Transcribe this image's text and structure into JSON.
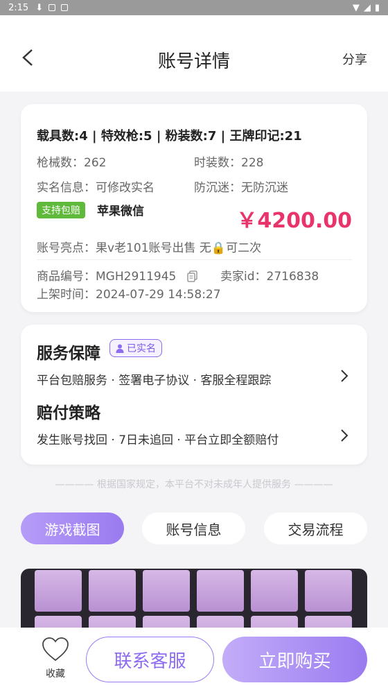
{
  "status_bar": {
    "time": "2:15"
  },
  "header": {
    "title": "账号详情",
    "share": "分享"
  },
  "account": {
    "summary": "载具数:4 | 特效枪:5 | 粉装数:7 | 王牌印记:21",
    "gun_label": "枪械数：",
    "gun_value": "262",
    "outfit_label": "时装数：",
    "outfit_value": "228",
    "realname_label": "实名信息：",
    "realname_value": "可修改实名",
    "addiction_label": "防沉迷：",
    "addiction_value": "无防沉迷",
    "guarantee_tag": "支持包赔",
    "platforms": "苹果微信",
    "price": "￥4200.00",
    "highlight_label": "账号亮点：",
    "highlight_value": "果v老101账号出售 无🔒可二次",
    "product_no_label": "商品编号：",
    "product_no": "MGH2911945",
    "seller_label": "卖家id：",
    "seller_id": "2716838",
    "listed_label": "上架时间：",
    "listed_time": "2024-07-29 14:58:27"
  },
  "service": {
    "title": "服务保障",
    "badge": "已实名",
    "desc": "平台包赔服务 · 签署电子协议 · 客服全程跟踪",
    "policy_title": "赔付策略",
    "policy_desc": "发生账号找回 · 7日未追回 · 平台立即全额赔付"
  },
  "notice": "———— 根据国家规定，本平台不对未成年人提供服务 ————",
  "tabs": [
    {
      "label": "游戏截图",
      "active": true
    },
    {
      "label": "账号信息",
      "active": false
    },
    {
      "label": "交易流程",
      "active": false
    }
  ],
  "bottom": {
    "fav_label": "收藏",
    "contact": "联系客服",
    "buy": "立即购买"
  },
  "colors": {
    "accent": "#9a7bf0",
    "price": "#e9336b",
    "green_tag": "#5fba3b"
  }
}
